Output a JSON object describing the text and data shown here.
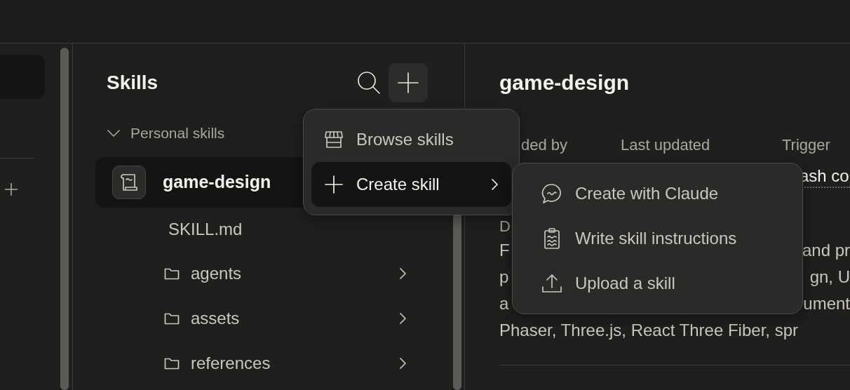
{
  "panel": {
    "title": "Skills"
  },
  "section": {
    "label": "Personal skills",
    "expanded": true
  },
  "skill": {
    "name": "game-design",
    "selected": true,
    "files": [
      {
        "kind": "file",
        "name": "SKILL.md"
      },
      {
        "kind": "folder",
        "name": "agents"
      },
      {
        "kind": "folder",
        "name": "assets"
      },
      {
        "kind": "folder",
        "name": "references"
      }
    ]
  },
  "menu": {
    "items": [
      {
        "kind": "store",
        "label": "Browse skills",
        "selected": false,
        "has_submenu": false
      },
      {
        "kind": "plus",
        "label": "Create skill",
        "selected": true,
        "has_submenu": true
      }
    ]
  },
  "submenu": {
    "items": [
      {
        "kind": "chat",
        "label": "Create with Claude"
      },
      {
        "kind": "clipboard",
        "label": "Write skill instructions"
      },
      {
        "kind": "upload",
        "label": "Upload a skill"
      }
    ]
  },
  "detail": {
    "title": "game-design",
    "meta_labels": [
      "ded by",
      "Last updated",
      "Trigger"
    ],
    "trigger_value": "ash co",
    "description_label": "D",
    "description_lines": [
      [
        "F",
        "and pr"
      ],
      [
        "p",
        "gn, U"
      ],
      [
        "a",
        "ument"
      ],
      [
        "Phaser, Three.js, React Three Fiber, spr"
      ]
    ]
  }
}
